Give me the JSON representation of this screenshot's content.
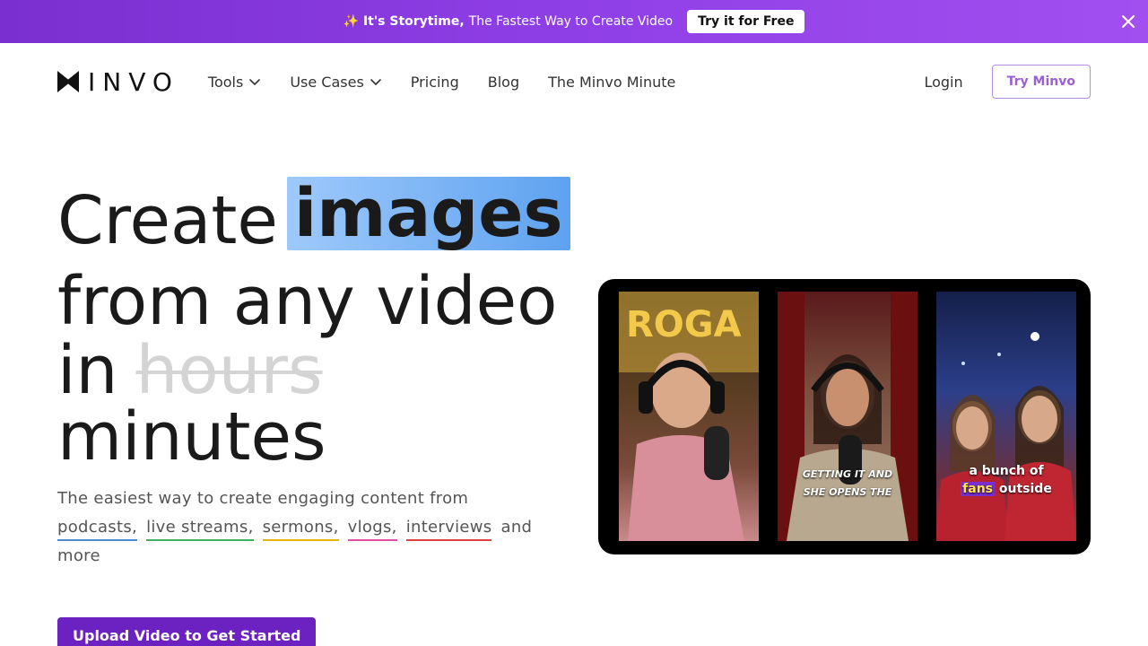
{
  "banner": {
    "sparkle": "✨",
    "strong": "It's Storytime,",
    "text": "The Fastest Way to Create Video",
    "cta": "Try it for Free"
  },
  "nav": {
    "logo_text": "INVO",
    "items": [
      {
        "label": "Tools",
        "dropdown": true
      },
      {
        "label": "Use Cases",
        "dropdown": true
      },
      {
        "label": "Pricing"
      },
      {
        "label": "Blog"
      },
      {
        "label": "The Minvo Minute"
      }
    ],
    "login": "Login",
    "try": "Try Minvo"
  },
  "hero": {
    "line1_prefix": "Create",
    "line1_highlight": "images",
    "line2": "from any video",
    "line3_prefix": "in",
    "line3_struck": "hours",
    "line4": "minutes",
    "sub_intro": "The easiest way to create engaging content from",
    "tags": [
      "podcasts,",
      "live streams,",
      "sermons,",
      "vlogs,",
      "interviews"
    ],
    "sub_outro": "and more",
    "cta": "Upload Video to Get Started"
  },
  "video": {
    "caption2_line1": "GETTING IT AND",
    "caption2_line2": "SHE OPENS THE",
    "caption3_pre": "a bunch of",
    "caption3_highlight": "fans",
    "caption3_post": "outside"
  },
  "colors": {
    "banner_start": "#7a2fd0",
    "banner_end": "#a24ff0",
    "highlight": "#5ea2f0",
    "primary": "#6b22c0"
  }
}
